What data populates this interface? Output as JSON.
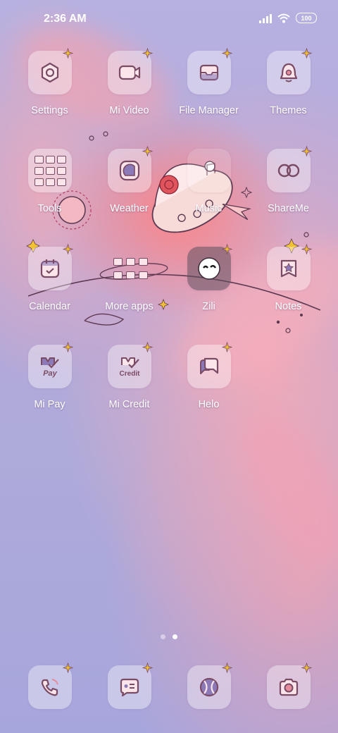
{
  "status_bar": {
    "time": "2:36 AM",
    "battery": "100",
    "icons": [
      "signal-icon",
      "wifi-icon",
      "battery-icon"
    ]
  },
  "apps": [
    {
      "label": "Settings",
      "icon": "settings-icon"
    },
    {
      "label": "Mi Video",
      "icon": "video-icon"
    },
    {
      "label": "File Manager",
      "icon": "file-manager-icon"
    },
    {
      "label": "Themes",
      "icon": "themes-icon"
    },
    {
      "label": "Tools",
      "icon": "tools-folder-icon"
    },
    {
      "label": "Weather",
      "icon": "weather-icon"
    },
    {
      "label": "Music",
      "icon": "music-icon"
    },
    {
      "label": "ShareMe",
      "icon": "shareme-icon"
    },
    {
      "label": "Calendar",
      "icon": "calendar-icon"
    },
    {
      "label": "More apps",
      "icon": "more-apps-folder-icon"
    },
    {
      "label": "Zili",
      "icon": "zili-icon"
    },
    {
      "label": "Notes",
      "icon": "notes-icon"
    },
    {
      "label": "Mi Pay",
      "icon": "mi-pay-icon",
      "icon_text": "Pay"
    },
    {
      "label": "Mi Credit",
      "icon": "mi-credit-icon",
      "icon_text": "Credit"
    },
    {
      "label": "Helo",
      "icon": "helo-icon"
    }
  ],
  "dock": [
    {
      "name": "phone",
      "icon": "phone-icon"
    },
    {
      "name": "messages",
      "icon": "messages-icon"
    },
    {
      "name": "browser",
      "icon": "browser-icon"
    },
    {
      "name": "camera",
      "icon": "camera-icon"
    }
  ],
  "page_indicator": {
    "total": 2,
    "active": 2
  },
  "colors": {
    "icon_stroke": "#7a4b64",
    "icon_fill": "#fbe5ea",
    "accent_glow": "#ff8c95",
    "sparkle": "#f2c230"
  }
}
